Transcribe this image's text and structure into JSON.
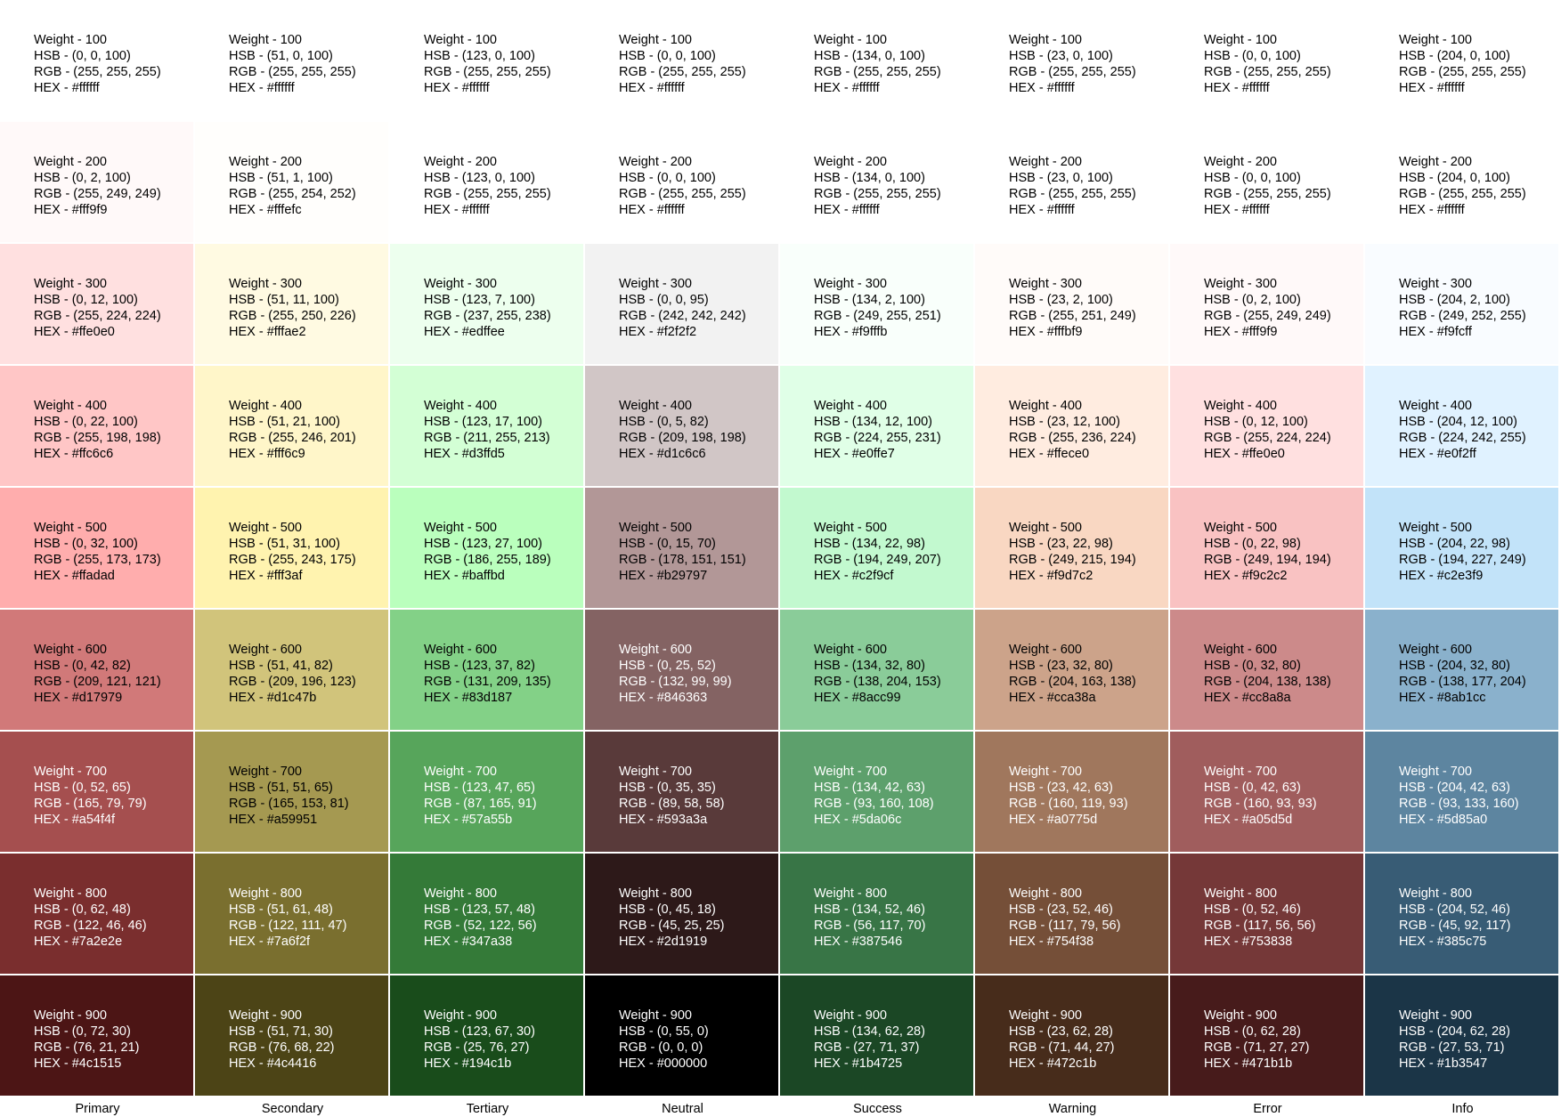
{
  "palette_columns": [
    {
      "label": "Primary",
      "swatches": [
        {
          "weight": "Weight - 100",
          "hsb": "HSB - (0, 0, 100)",
          "rgb": "RGB - (255, 255, 255)",
          "hex": "HEX - #ffffff",
          "color": "#ffffff",
          "text_color": "#000000"
        },
        {
          "weight": "Weight - 200",
          "hsb": "HSB - (0, 2, 100)",
          "rgb": "RGB - (255, 249, 249)",
          "hex": "HEX - #fff9f9",
          "color": "#fff9f9",
          "text_color": "#000000"
        },
        {
          "weight": "Weight - 300",
          "hsb": "HSB - (0, 12, 100)",
          "rgb": "RGB - (255, 224, 224)",
          "hex": "HEX - #ffe0e0",
          "color": "#ffe0e0",
          "text_color": "#000000"
        },
        {
          "weight": "Weight - 400",
          "hsb": "HSB - (0, 22, 100)",
          "rgb": "RGB - (255, 198, 198)",
          "hex": "HEX - #ffc6c6",
          "color": "#ffc6c6",
          "text_color": "#000000"
        },
        {
          "weight": "Weight - 500",
          "hsb": "HSB - (0, 32, 100)",
          "rgb": "RGB - (255, 173, 173)",
          "hex": "HEX - #ffadad",
          "color": "#ffadad",
          "text_color": "#000000"
        },
        {
          "weight": "Weight - 600",
          "hsb": "HSB - (0, 42, 82)",
          "rgb": "RGB - (209, 121, 121)",
          "hex": "HEX - #d17979",
          "color": "#d17979",
          "text_color": "#000000"
        },
        {
          "weight": "Weight - 700",
          "hsb": "HSB - (0, 52, 65)",
          "rgb": "RGB - (165, 79, 79)",
          "hex": "HEX - #a54f4f",
          "color": "#a54f4f",
          "text_color": "#ffffff"
        },
        {
          "weight": "Weight - 800",
          "hsb": "HSB - (0, 62, 48)",
          "rgb": "RGB - (122, 46, 46)",
          "hex": "HEX - #7a2e2e",
          "color": "#7a2e2e",
          "text_color": "#ffffff"
        },
        {
          "weight": "Weight - 900",
          "hsb": "HSB - (0, 72, 30)",
          "rgb": "RGB - (76, 21, 21)",
          "hex": "HEX - #4c1515",
          "color": "#4c1515",
          "text_color": "#ffffff"
        }
      ]
    },
    {
      "label": "Secondary",
      "swatches": [
        {
          "weight": "Weight - 100",
          "hsb": "HSB - (51, 0, 100)",
          "rgb": "RGB - (255, 255, 255)",
          "hex": "HEX - #ffffff",
          "color": "#ffffff",
          "text_color": "#000000"
        },
        {
          "weight": "Weight - 200",
          "hsb": "HSB - (51, 1, 100)",
          "rgb": "RGB - (255, 254, 252)",
          "hex": "HEX - #fffefc",
          "color": "#fffefc",
          "text_color": "#000000"
        },
        {
          "weight": "Weight - 300",
          "hsb": "HSB - (51, 11, 100)",
          "rgb": "RGB - (255, 250, 226)",
          "hex": "HEX - #fffae2",
          "color": "#fffae2",
          "text_color": "#000000"
        },
        {
          "weight": "Weight - 400",
          "hsb": "HSB - (51, 21, 100)",
          "rgb": "RGB - (255, 246, 201)",
          "hex": "HEX - #fff6c9",
          "color": "#fff6c9",
          "text_color": "#000000"
        },
        {
          "weight": "Weight - 500",
          "hsb": "HSB - (51, 31, 100)",
          "rgb": "RGB - (255, 243, 175)",
          "hex": "HEX - #fff3af",
          "color": "#fff3af",
          "text_color": "#000000"
        },
        {
          "weight": "Weight - 600",
          "hsb": "HSB - (51, 41, 82)",
          "rgb": "RGB - (209, 196, 123)",
          "hex": "HEX - #d1c47b",
          "color": "#d1c47b",
          "text_color": "#000000"
        },
        {
          "weight": "Weight - 700",
          "hsb": "HSB - (51, 51, 65)",
          "rgb": "RGB - (165, 153, 81)",
          "hex": "HEX - #a59951",
          "color": "#a59951",
          "text_color": "#000000"
        },
        {
          "weight": "Weight - 800",
          "hsb": "HSB - (51, 61, 48)",
          "rgb": "RGB - (122, 111, 47)",
          "hex": "HEX - #7a6f2f",
          "color": "#7a6f2f",
          "text_color": "#ffffff"
        },
        {
          "weight": "Weight - 900",
          "hsb": "HSB - (51, 71, 30)",
          "rgb": "RGB - (76, 68, 22)",
          "hex": "HEX - #4c4416",
          "color": "#4c4416",
          "text_color": "#ffffff"
        }
      ]
    },
    {
      "label": "Tertiary",
      "swatches": [
        {
          "weight": "Weight - 100",
          "hsb": "HSB - (123, 0, 100)",
          "rgb": "RGB - (255, 255, 255)",
          "hex": "HEX - #ffffff",
          "color": "#ffffff",
          "text_color": "#000000"
        },
        {
          "weight": "Weight - 200",
          "hsb": "HSB - (123, 0, 100)",
          "rgb": "RGB - (255, 255, 255)",
          "hex": "HEX - #ffffff",
          "color": "#ffffff",
          "text_color": "#000000"
        },
        {
          "weight": "Weight - 300",
          "hsb": "HSB - (123, 7, 100)",
          "rgb": "RGB - (237, 255, 238)",
          "hex": "HEX - #edffee",
          "color": "#edffee",
          "text_color": "#000000"
        },
        {
          "weight": "Weight - 400",
          "hsb": "HSB - (123, 17, 100)",
          "rgb": "RGB - (211, 255, 213)",
          "hex": "HEX - #d3ffd5",
          "color": "#d3ffd5",
          "text_color": "#000000"
        },
        {
          "weight": "Weight - 500",
          "hsb": "HSB - (123, 27, 100)",
          "rgb": "RGB - (186, 255, 189)",
          "hex": "HEX - #baffbd",
          "color": "#baffbd",
          "text_color": "#000000"
        },
        {
          "weight": "Weight - 600",
          "hsb": "HSB - (123, 37, 82)",
          "rgb": "RGB - (131, 209, 135)",
          "hex": "HEX - #83d187",
          "color": "#83d187",
          "text_color": "#000000"
        },
        {
          "weight": "Weight - 700",
          "hsb": "HSB - (123, 47, 65)",
          "rgb": "RGB - (87, 165, 91)",
          "hex": "HEX - #57a55b",
          "color": "#57a55b",
          "text_color": "#ffffff"
        },
        {
          "weight": "Weight - 800",
          "hsb": "HSB - (123, 57, 48)",
          "rgb": "RGB - (52, 122, 56)",
          "hex": "HEX - #347a38",
          "color": "#347a38",
          "text_color": "#ffffff"
        },
        {
          "weight": "Weight - 900",
          "hsb": "HSB - (123, 67, 30)",
          "rgb": "RGB - (25, 76, 27)",
          "hex": "HEX - #194c1b",
          "color": "#194c1b",
          "text_color": "#ffffff"
        }
      ]
    },
    {
      "label": "Neutral",
      "swatches": [
        {
          "weight": "Weight - 100",
          "hsb": "HSB - (0, 0, 100)",
          "rgb": "RGB - (255, 255, 255)",
          "hex": "HEX - #ffffff",
          "color": "#ffffff",
          "text_color": "#000000"
        },
        {
          "weight": "Weight - 200",
          "hsb": "HSB - (0, 0, 100)",
          "rgb": "RGB - (255, 255, 255)",
          "hex": "HEX - #ffffff",
          "color": "#ffffff",
          "text_color": "#000000"
        },
        {
          "weight": "Weight - 300",
          "hsb": "HSB - (0, 0, 95)",
          "rgb": "RGB - (242, 242, 242)",
          "hex": "HEX - #f2f2f2",
          "color": "#f2f2f2",
          "text_color": "#000000"
        },
        {
          "weight": "Weight - 400",
          "hsb": "HSB - (0, 5, 82)",
          "rgb": "RGB - (209, 198, 198)",
          "hex": "HEX - #d1c6c6",
          "color": "#d1c6c6",
          "text_color": "#000000"
        },
        {
          "weight": "Weight - 500",
          "hsb": "HSB - (0, 15, 70)",
          "rgb": "RGB - (178, 151, 151)",
          "hex": "HEX - #b29797",
          "color": "#b29797",
          "text_color": "#000000"
        },
        {
          "weight": "Weight - 600",
          "hsb": "HSB - (0, 25, 52)",
          "rgb": "RGB - (132, 99, 99)",
          "hex": "HEX - #846363",
          "color": "#846363",
          "text_color": "#ffffff"
        },
        {
          "weight": "Weight - 700",
          "hsb": "HSB - (0, 35, 35)",
          "rgb": "RGB - (89, 58, 58)",
          "hex": "HEX - #593a3a",
          "color": "#593a3a",
          "text_color": "#ffffff"
        },
        {
          "weight": "Weight - 800",
          "hsb": "HSB - (0, 45, 18)",
          "rgb": "RGB - (45, 25, 25)",
          "hex": "HEX - #2d1919",
          "color": "#2d1919",
          "text_color": "#ffffff"
        },
        {
          "weight": "Weight - 900",
          "hsb": "HSB - (0, 55, 0)",
          "rgb": "RGB - (0, 0, 0)",
          "hex": "HEX - #000000",
          "color": "#000000",
          "text_color": "#ffffff"
        }
      ]
    },
    {
      "label": "Success",
      "swatches": [
        {
          "weight": "Weight - 100",
          "hsb": "HSB - (134, 0, 100)",
          "rgb": "RGB - (255, 255, 255)",
          "hex": "HEX - #ffffff",
          "color": "#ffffff",
          "text_color": "#000000"
        },
        {
          "weight": "Weight - 200",
          "hsb": "HSB - (134, 0, 100)",
          "rgb": "RGB - (255, 255, 255)",
          "hex": "HEX - #ffffff",
          "color": "#ffffff",
          "text_color": "#000000"
        },
        {
          "weight": "Weight - 300",
          "hsb": "HSB - (134, 2, 100)",
          "rgb": "RGB - (249, 255, 251)",
          "hex": "HEX - #f9fffb",
          "color": "#f9fffb",
          "text_color": "#000000"
        },
        {
          "weight": "Weight - 400",
          "hsb": "HSB - (134, 12, 100)",
          "rgb": "RGB - (224, 255, 231)",
          "hex": "HEX - #e0ffe7",
          "color": "#e0ffe7",
          "text_color": "#000000"
        },
        {
          "weight": "Weight - 500",
          "hsb": "HSB - (134, 22, 98)",
          "rgb": "RGB - (194, 249, 207)",
          "hex": "HEX - #c2f9cf",
          "color": "#c2f9cf",
          "text_color": "#000000"
        },
        {
          "weight": "Weight - 600",
          "hsb": "HSB - (134, 32, 80)",
          "rgb": "RGB - (138, 204, 153)",
          "hex": "HEX - #8acc99",
          "color": "#8acc99",
          "text_color": "#000000"
        },
        {
          "weight": "Weight - 700",
          "hsb": "HSB - (134, 42, 63)",
          "rgb": "RGB - (93, 160, 108)",
          "hex": "HEX - #5da06c",
          "color": "#5da06c",
          "text_color": "#ffffff"
        },
        {
          "weight": "Weight - 800",
          "hsb": "HSB - (134, 52, 46)",
          "rgb": "RGB - (56, 117, 70)",
          "hex": "HEX - #387546",
          "color": "#387546",
          "text_color": "#ffffff"
        },
        {
          "weight": "Weight - 900",
          "hsb": "HSB - (134, 62, 28)",
          "rgb": "RGB - (27, 71, 37)",
          "hex": "HEX - #1b4725",
          "color": "#1b4725",
          "text_color": "#ffffff"
        }
      ]
    },
    {
      "label": "Warning",
      "swatches": [
        {
          "weight": "Weight - 100",
          "hsb": "HSB - (23, 0, 100)",
          "rgb": "RGB - (255, 255, 255)",
          "hex": "HEX - #ffffff",
          "color": "#ffffff",
          "text_color": "#000000"
        },
        {
          "weight": "Weight - 200",
          "hsb": "HSB - (23, 0, 100)",
          "rgb": "RGB - (255, 255, 255)",
          "hex": "HEX - #ffffff",
          "color": "#ffffff",
          "text_color": "#000000"
        },
        {
          "weight": "Weight - 300",
          "hsb": "HSB - (23, 2, 100)",
          "rgb": "RGB - (255, 251, 249)",
          "hex": "HEX - #fffbf9",
          "color": "#fffbf9",
          "text_color": "#000000"
        },
        {
          "weight": "Weight - 400",
          "hsb": "HSB - (23, 12, 100)",
          "rgb": "RGB - (255, 236, 224)",
          "hex": "HEX - #ffece0",
          "color": "#ffece0",
          "text_color": "#000000"
        },
        {
          "weight": "Weight - 500",
          "hsb": "HSB - (23, 22, 98)",
          "rgb": "RGB - (249, 215, 194)",
          "hex": "HEX - #f9d7c2",
          "color": "#f9d7c2",
          "text_color": "#000000"
        },
        {
          "weight": "Weight - 600",
          "hsb": "HSB - (23, 32, 80)",
          "rgb": "RGB - (204, 163, 138)",
          "hex": "HEX - #cca38a",
          "color": "#cca38a",
          "text_color": "#000000"
        },
        {
          "weight": "Weight - 700",
          "hsb": "HSB - (23, 42, 63)",
          "rgb": "RGB - (160, 119, 93)",
          "hex": "HEX - #a0775d",
          "color": "#a0775d",
          "text_color": "#ffffff"
        },
        {
          "weight": "Weight - 800",
          "hsb": "HSB - (23, 52, 46)",
          "rgb": "RGB - (117, 79, 56)",
          "hex": "HEX - #754f38",
          "color": "#754f38",
          "text_color": "#ffffff"
        },
        {
          "weight": "Weight - 900",
          "hsb": "HSB - (23, 62, 28)",
          "rgb": "RGB - (71, 44, 27)",
          "hex": "HEX - #472c1b",
          "color": "#472c1b",
          "text_color": "#ffffff"
        }
      ]
    },
    {
      "label": "Error",
      "swatches": [
        {
          "weight": "Weight - 100",
          "hsb": "HSB - (0, 0, 100)",
          "rgb": "RGB - (255, 255, 255)",
          "hex": "HEX - #ffffff",
          "color": "#ffffff",
          "text_color": "#000000"
        },
        {
          "weight": "Weight - 200",
          "hsb": "HSB - (0, 0, 100)",
          "rgb": "RGB - (255, 255, 255)",
          "hex": "HEX - #ffffff",
          "color": "#ffffff",
          "text_color": "#000000"
        },
        {
          "weight": "Weight - 300",
          "hsb": "HSB - (0, 2, 100)",
          "rgb": "RGB - (255, 249, 249)",
          "hex": "HEX - #fff9f9",
          "color": "#fff9f9",
          "text_color": "#000000"
        },
        {
          "weight": "Weight - 400",
          "hsb": "HSB - (0, 12, 100)",
          "rgb": "RGB - (255, 224, 224)",
          "hex": "HEX - #ffe0e0",
          "color": "#ffe0e0",
          "text_color": "#000000"
        },
        {
          "weight": "Weight - 500",
          "hsb": "HSB - (0, 22, 98)",
          "rgb": "RGB - (249, 194, 194)",
          "hex": "HEX - #f9c2c2",
          "color": "#f9c2c2",
          "text_color": "#000000"
        },
        {
          "weight": "Weight - 600",
          "hsb": "HSB - (0, 32, 80)",
          "rgb": "RGB - (204, 138, 138)",
          "hex": "HEX - #cc8a8a",
          "color": "#cc8a8a",
          "text_color": "#000000"
        },
        {
          "weight": "Weight - 700",
          "hsb": "HSB - (0, 42, 63)",
          "rgb": "RGB - (160, 93, 93)",
          "hex": "HEX - #a05d5d",
          "color": "#a05d5d",
          "text_color": "#ffffff"
        },
        {
          "weight": "Weight - 800",
          "hsb": "HSB - (0, 52, 46)",
          "rgb": "RGB - (117, 56, 56)",
          "hex": "HEX - #753838",
          "color": "#753838",
          "text_color": "#ffffff"
        },
        {
          "weight": "Weight - 900",
          "hsb": "HSB - (0, 62, 28)",
          "rgb": "RGB - (71, 27, 27)",
          "hex": "HEX - #471b1b",
          "color": "#471b1b",
          "text_color": "#ffffff"
        }
      ]
    },
    {
      "label": "Info",
      "swatches": [
        {
          "weight": "Weight - 100",
          "hsb": "HSB - (204, 0, 100)",
          "rgb": "RGB - (255, 255, 255)",
          "hex": "HEX - #ffffff",
          "color": "#ffffff",
          "text_color": "#000000"
        },
        {
          "weight": "Weight - 200",
          "hsb": "HSB - (204, 0, 100)",
          "rgb": "RGB - (255, 255, 255)",
          "hex": "HEX - #ffffff",
          "color": "#ffffff",
          "text_color": "#000000"
        },
        {
          "weight": "Weight - 300",
          "hsb": "HSB - (204, 2, 100)",
          "rgb": "RGB - (249, 252, 255)",
          "hex": "HEX - #f9fcff",
          "color": "#f9fcff",
          "text_color": "#000000"
        },
        {
          "weight": "Weight - 400",
          "hsb": "HSB - (204, 12, 100)",
          "rgb": "RGB - (224, 242, 255)",
          "hex": "HEX - #e0f2ff",
          "color": "#e0f2ff",
          "text_color": "#000000"
        },
        {
          "weight": "Weight - 500",
          "hsb": "HSB - (204, 22, 98)",
          "rgb": "RGB - (194, 227, 249)",
          "hex": "HEX - #c2e3f9",
          "color": "#c2e3f9",
          "text_color": "#000000"
        },
        {
          "weight": "Weight - 600",
          "hsb": "HSB - (204, 32, 80)",
          "rgb": "RGB - (138, 177, 204)",
          "hex": "HEX - #8ab1cc",
          "color": "#8ab1cc",
          "text_color": "#000000"
        },
        {
          "weight": "Weight - 700",
          "hsb": "HSB - (204, 42, 63)",
          "rgb": "RGB - (93, 133, 160)",
          "hex": "HEX - #5d85a0",
          "color": "#5d85a0",
          "text_color": "#ffffff"
        },
        {
          "weight": "Weight - 800",
          "hsb": "HSB - (204, 52, 46)",
          "rgb": "RGB - (45, 92, 117)",
          "hex": "HEX - #385c75",
          "color": "#385c75",
          "text_color": "#ffffff"
        },
        {
          "weight": "Weight - 900",
          "hsb": "HSB - (204, 62, 28)",
          "rgb": "RGB - (27, 53, 71)",
          "hex": "HEX - #1b3547",
          "color": "#1b3547",
          "text_color": "#ffffff"
        }
      ]
    }
  ]
}
